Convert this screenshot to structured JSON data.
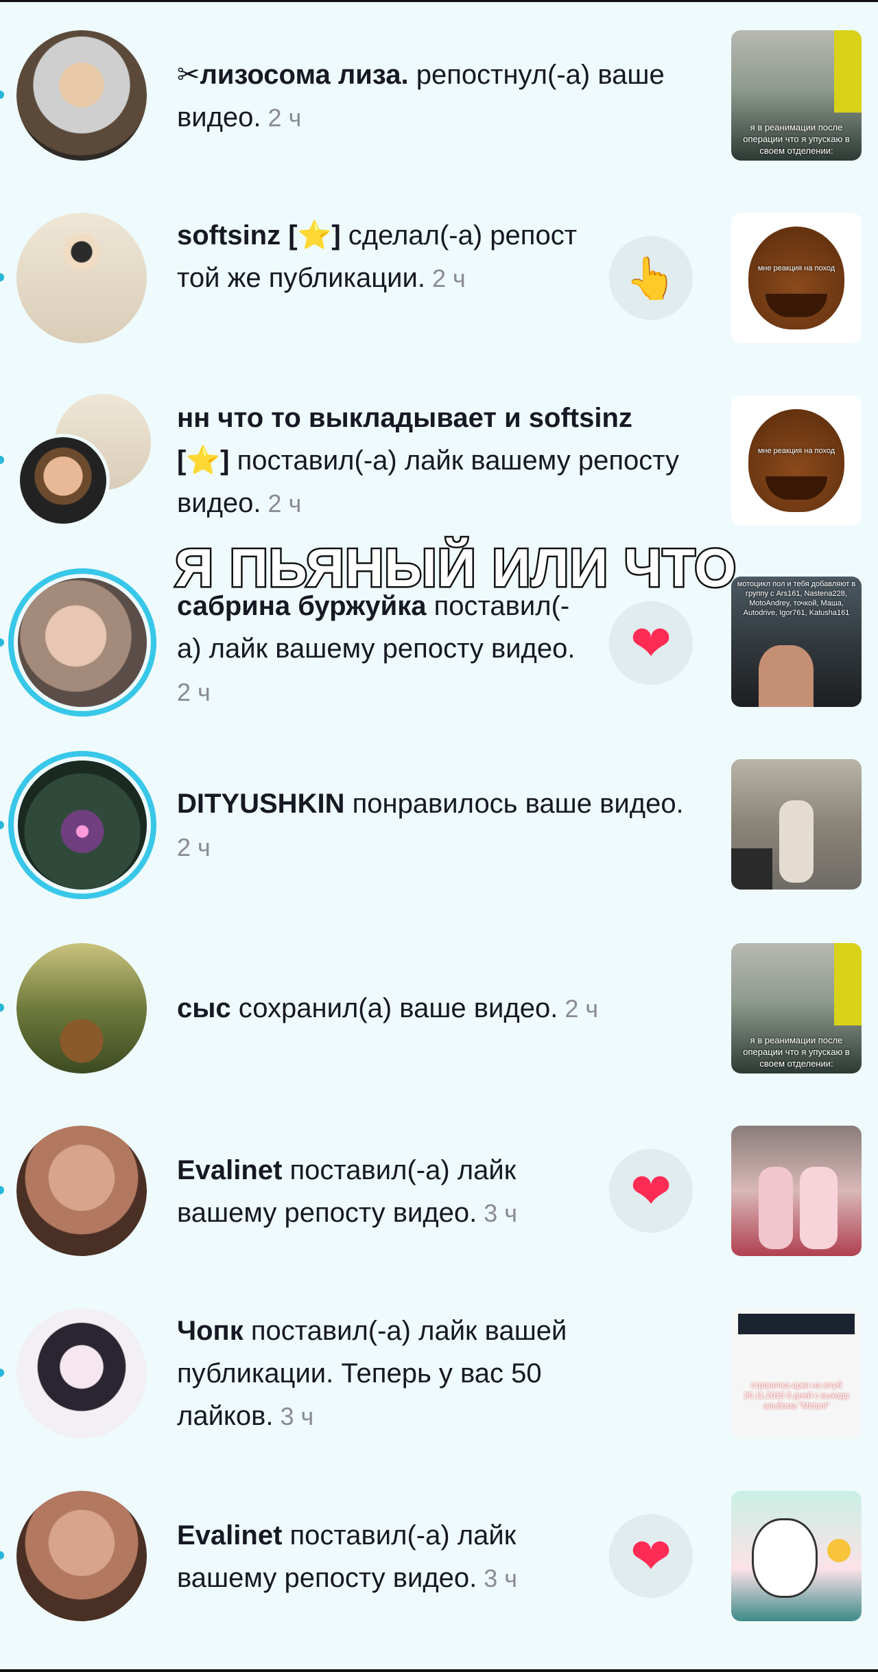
{
  "overlay_text": "Я ПЬЯНЫЙ ИЛИ ЧТО",
  "colors": {
    "background": "#eefafc",
    "accent": "#27b6d9",
    "heart": "#fe2c55",
    "time": "#8a8b91"
  },
  "notifications": [
    {
      "user": "✂лизосома лиза.",
      "text": " репостнул(-а) ваше видео.",
      "time": " 2 ч",
      "avatar_icon": "anime-avatar",
      "thumb_caption": "я в реанимации после операции что я упускаю в своем отделении:"
    },
    {
      "user": "softsinz [⭐]",
      "text": " сделал(-а) репост той же публикации.",
      "time": " 2 ч",
      "avatar_icon": "roblox-avatar",
      "action_icon": "pointing-hand-icon",
      "action_glyph": "👆",
      "thumb_caption": "мне реакция на поход"
    },
    {
      "user": "нн что то выкладывает и softsinz [⭐]",
      "text": " поставил(-а) лайк вашему репосту видео.",
      "time": " 2 ч",
      "avatar_icon": "double-avatar",
      "thumb_caption": "мне реакция на поход"
    },
    {
      "user": "сабрина буржуйка",
      "text": " поставил(-а) лайк вашему репосту видео.",
      "time": " 2 ч",
      "avatar_icon": "photo-avatar",
      "action_icon": "heart-icon",
      "action_glyph": "❤",
      "thumb_caption": "мотоцикл пол и тебя добавляют в группу с Ars161, Nastena228, MotoAndrey, точкой, Маша, Autodrive, Igor761, Katusha161"
    },
    {
      "user": "DITYUSHKIN",
      "text": " понравилось ваше видео.",
      "time": " 2 ч",
      "avatar_icon": "forest-light-avatar",
      "thumb_caption": ""
    },
    {
      "user": "сыс",
      "text": " сохранил(а) ваше видео.",
      "time": " 2 ч",
      "avatar_icon": "painting-avatar",
      "thumb_caption": "я в реанимации после операции что я упускаю в своем отделении:"
    },
    {
      "user": "Evalinet",
      "text": " поставил(-а) лайк вашему репосту видео.",
      "time": " 3 ч",
      "avatar_icon": "bald-man-avatar",
      "action_icon": "heart-icon",
      "action_glyph": "❤",
      "thumb_caption": ""
    },
    {
      "user": "Чопк",
      "text": " поставил(-а) лайк вашей публикации. Теперь у вас 50 лайков.",
      "time": " 3 ч",
      "avatar_icon": "anime-girl-avatar",
      "thumb_caption": "страничка арки на ютуб 26.11.2015 6 дней с выхода альбома \"Mirtani\""
    },
    {
      "user": "Evalinet",
      "text": " поставил(-а) лайк вашему репосту видео.",
      "time": " 3 ч",
      "avatar_icon": "bald-man-avatar",
      "action_icon": "heart-icon",
      "action_glyph": "❤",
      "thumb_caption": ""
    }
  ]
}
